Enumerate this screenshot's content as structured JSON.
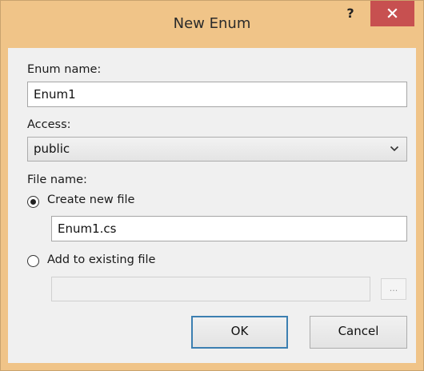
{
  "window": {
    "title": "New Enum",
    "help_glyph": "?",
    "close_icon": "close-icon"
  },
  "form": {
    "enum_name_label": "Enum name:",
    "enum_name_value": "Enum1",
    "access_label": "Access:",
    "access_value": "public",
    "file_name_label": "File name:",
    "create_new_label": "Create new file",
    "create_new_selected": true,
    "new_file_value": "Enum1.cs",
    "add_existing_label": "Add to existing file",
    "add_existing_selected": false,
    "existing_file_value": "",
    "browse_label": "..."
  },
  "buttons": {
    "ok_label": "OK",
    "cancel_label": "Cancel"
  },
  "colors": {
    "titlebar": "#f0c488",
    "close_button": "#c75050",
    "default_button_border": "#3c7fb1"
  }
}
